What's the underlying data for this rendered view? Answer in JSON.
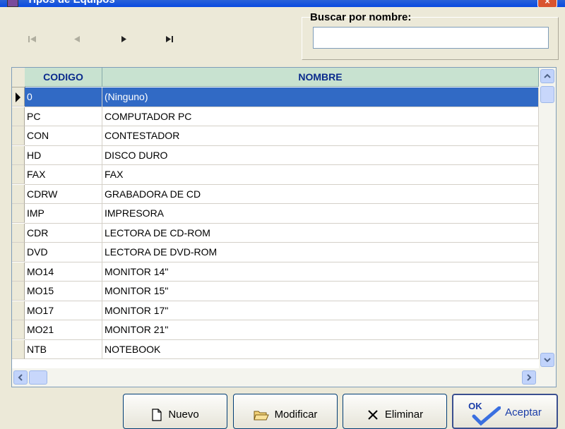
{
  "window": {
    "title": "Tipos de Equipos",
    "close_glyph": "×"
  },
  "nav": {
    "first_icon": "first-record-icon",
    "prev_icon": "previous-record-icon",
    "next_icon": "next-record-icon",
    "last_icon": "last-record-icon"
  },
  "search": {
    "label": "Buscar por nombre:",
    "value": "",
    "placeholder": ""
  },
  "grid": {
    "columns": [
      "CODIGO",
      "NOMBRE"
    ],
    "selected_index": 0,
    "rows": [
      {
        "codigo": "0",
        "nombre": "(Ninguno)"
      },
      {
        "codigo": "PC",
        "nombre": "COMPUTADOR PC"
      },
      {
        "codigo": "CON",
        "nombre": "CONTESTADOR"
      },
      {
        "codigo": "HD",
        "nombre": "DISCO DURO"
      },
      {
        "codigo": "FAX",
        "nombre": "FAX"
      },
      {
        "codigo": "CDRW",
        "nombre": "GRABADORA DE CD"
      },
      {
        "codigo": "IMP",
        "nombre": "IMPRESORA"
      },
      {
        "codigo": "CDR",
        "nombre": "LECTORA DE CD-ROM"
      },
      {
        "codigo": "DVD",
        "nombre": "LECTORA DE DVD-ROM"
      },
      {
        "codigo": "MO14",
        "nombre": "MONITOR 14\""
      },
      {
        "codigo": "MO15",
        "nombre": "MONITOR 15\""
      },
      {
        "codigo": "MO17",
        "nombre": "MONITOR 17\""
      },
      {
        "codigo": "MO21",
        "nombre": "MONITOR 21\""
      },
      {
        "codigo": "NTB",
        "nombre": "NOTEBOOK"
      }
    ]
  },
  "buttons": {
    "nuevo": "Nuevo",
    "modificar": "Modificar",
    "eliminar": "Eliminar",
    "aceptar": "Aceptar",
    "ok_badge": "OK"
  },
  "colors": {
    "selection": "#316ac5",
    "header_bg": "#c8e2d0",
    "header_text": "#0a2a8c"
  }
}
